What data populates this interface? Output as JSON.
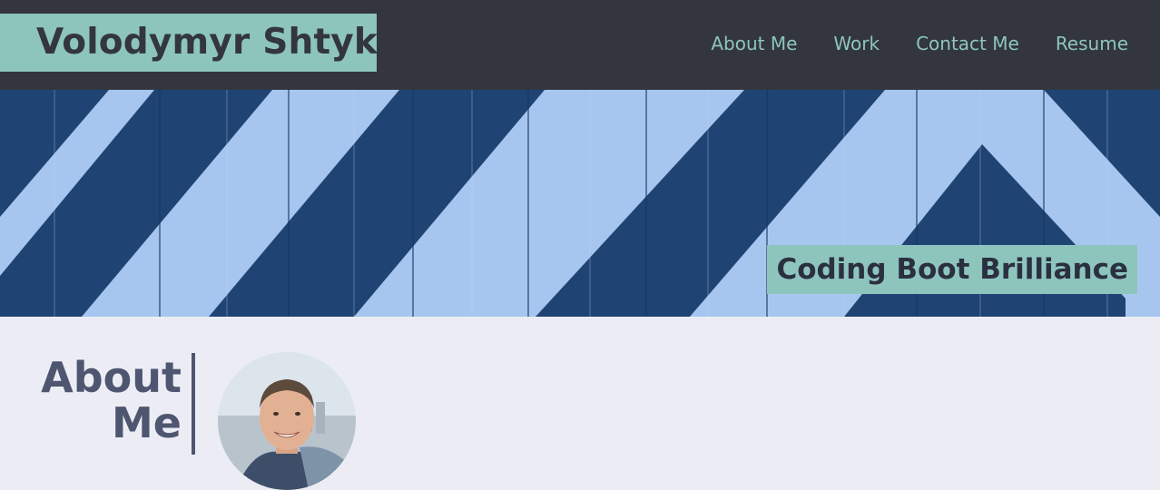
{
  "header": {
    "site_title": "Volodymyr Shtyka",
    "nav": [
      {
        "label": "About Me"
      },
      {
        "label": "Work"
      },
      {
        "label": "Contact Me"
      },
      {
        "label": "Resume"
      }
    ]
  },
  "hero": {
    "tagline": "Coding Boot Brilliance"
  },
  "about": {
    "heading_line1": "About",
    "heading_line2": "Me"
  },
  "colors": {
    "header_bg": "#33363e",
    "accent": "#8dc5bd",
    "hero_light": "#a6c6ef",
    "hero_dark": "#1f4474",
    "page_bg": "#ecedf4",
    "heading": "#4e5670"
  }
}
